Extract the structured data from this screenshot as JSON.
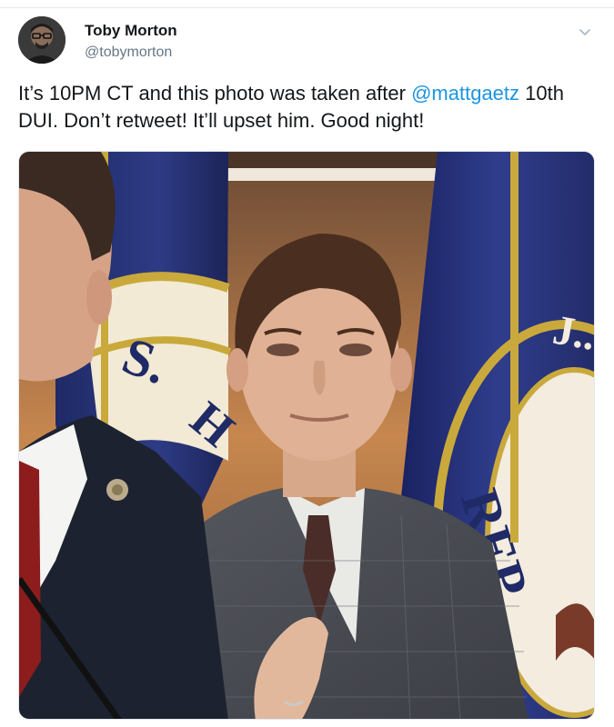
{
  "tweet": {
    "author": {
      "display_name": "Toby Morton",
      "handle": "@tobymorton"
    },
    "text_before": "It’s 10PM CT and this photo was taken after ",
    "mention": "@mattgaetz",
    "text_after": " 10th DUI. Don’t retweet! It’ll upset him. Good night!",
    "media": {
      "flag_lettering_left": "S.",
      "flag_lettering_left_2": "H",
      "flag_lettering_right": "REP",
      "flag_lettering_right_top": "J.."
    }
  },
  "colors": {
    "link": "#1b95e0",
    "secondary_text": "#657786",
    "flag_blue": "#27306b",
    "gold": "#c9a93c"
  },
  "icons": {
    "more": "chevron-down-icon"
  }
}
